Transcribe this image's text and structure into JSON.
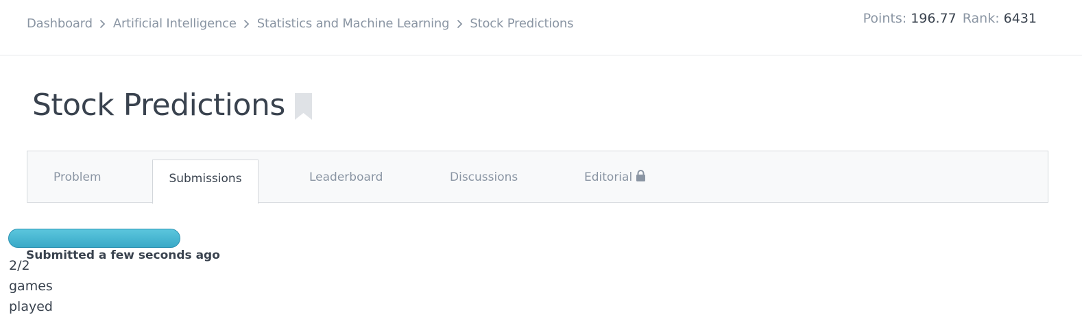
{
  "breadcrumb": {
    "items": [
      "Dashboard",
      "Artificial Intelligence",
      "Statistics and Machine Learning",
      "Stock Predictions"
    ]
  },
  "stats": {
    "points_label": "Points:",
    "points_value": "196.77",
    "rank_label": "Rank:",
    "rank_value": "6431"
  },
  "page": {
    "title": "Stock Predictions",
    "bookmark_icon": "bookmark-icon"
  },
  "tabs": [
    {
      "label": "Problem",
      "active": false
    },
    {
      "label": "Submissions",
      "active": true
    },
    {
      "label": "Leaderboard",
      "active": false
    },
    {
      "label": "Discussions",
      "active": false
    },
    {
      "label": "Editorial",
      "active": false,
      "icon": "lock-icon"
    }
  ],
  "submission": {
    "progress_fraction": 1.0,
    "status_text": "Submitted a few seconds ago",
    "games_count": "2/2",
    "games_word1": "games",
    "games_word2": "played"
  },
  "colors": {
    "progress": "#39a9c7",
    "text": "#39424e",
    "muted": "#8a95a3"
  }
}
